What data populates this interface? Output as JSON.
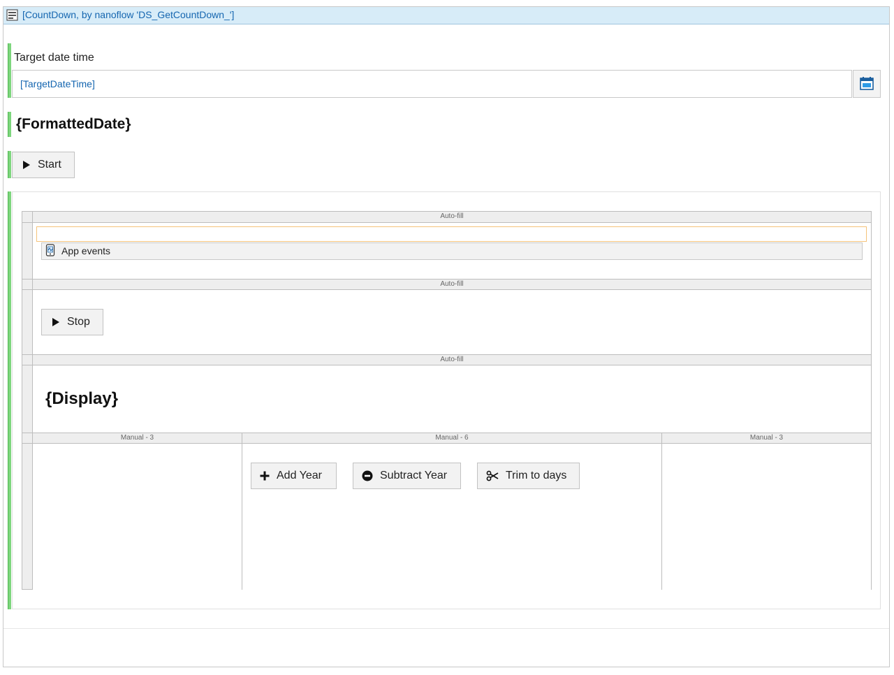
{
  "dataview": {
    "title": "[CountDown, by nanoflow 'DS_GetCountDown_']",
    "icon": "dataview-icon"
  },
  "target": {
    "label": "Target date time",
    "value": "[TargetDateTime]",
    "calendar_icon": "calendar-icon"
  },
  "formatted_date": "{FormattedDate}",
  "start_button": {
    "label": "Start",
    "icon": "play-icon"
  },
  "layout_grid": {
    "row1_header": "Auto-fill",
    "app_events_label": "App events",
    "row2_header": "Auto-fill",
    "stop_button": {
      "label": "Stop",
      "icon": "play-icon"
    },
    "row3_header": "Auto-fill",
    "display": "{Display}",
    "columns": [
      {
        "header": "Manual - 3"
      },
      {
        "header": "Manual - 6"
      },
      {
        "header": "Manual - 3"
      }
    ],
    "add_year_button": {
      "label": "Add Year",
      "icon": "plus-icon"
    },
    "subtract_year_button": {
      "label": "Subtract Year",
      "icon": "minus-circle-icon"
    },
    "trim_button": {
      "label": "Trim to days",
      "icon": "scissors-icon"
    }
  },
  "colors": {
    "header_bg": "#d7ecf8",
    "link_blue": "#1566b0",
    "green_marker": "#7ed67e",
    "selection_orange": "#f5c37a"
  }
}
